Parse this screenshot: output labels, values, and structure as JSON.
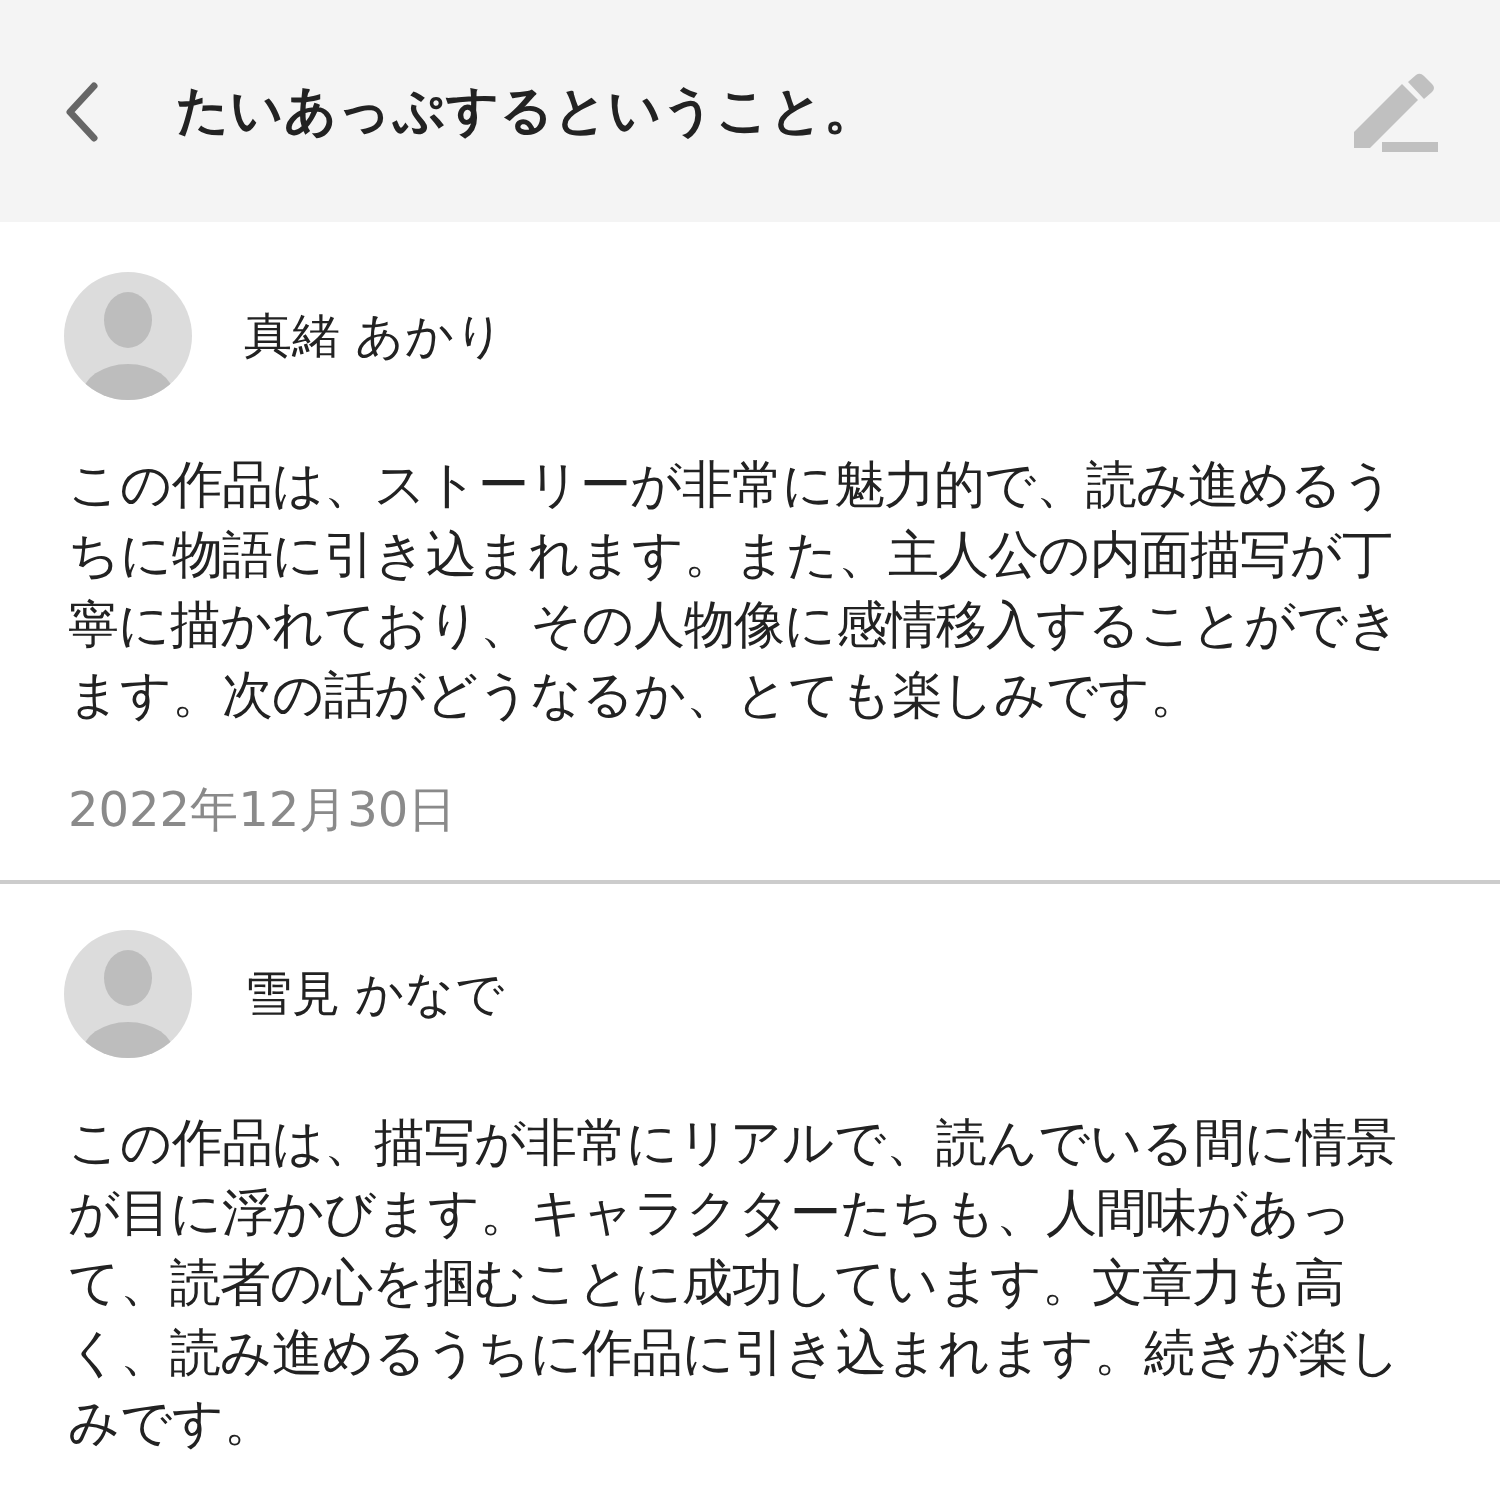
{
  "header": {
    "title": "たいあっぷするということ。"
  },
  "comments": [
    {
      "author": "真緒 あかり",
      "body": "この作品は、ストーリーが非常に魅力的で、読み進めるうちに物語に引き込まれます。また、主人公の内面描写が丁寧に描かれており、その人物像に感情移入することができます。次の話がどうなるか、とても楽しみです。",
      "date": "2022年12月30日"
    },
    {
      "author": "雪見 かなで",
      "body": "この作品は、描写が非常にリアルで、読んでいる間に情景が目に浮かびます。キャラクターたちも、人間味があって、読者の心を掴むことに成功しています。文章力も高く、読み進めるうちに作品に引き込まれます。続きが楽しみです。"
    }
  ]
}
